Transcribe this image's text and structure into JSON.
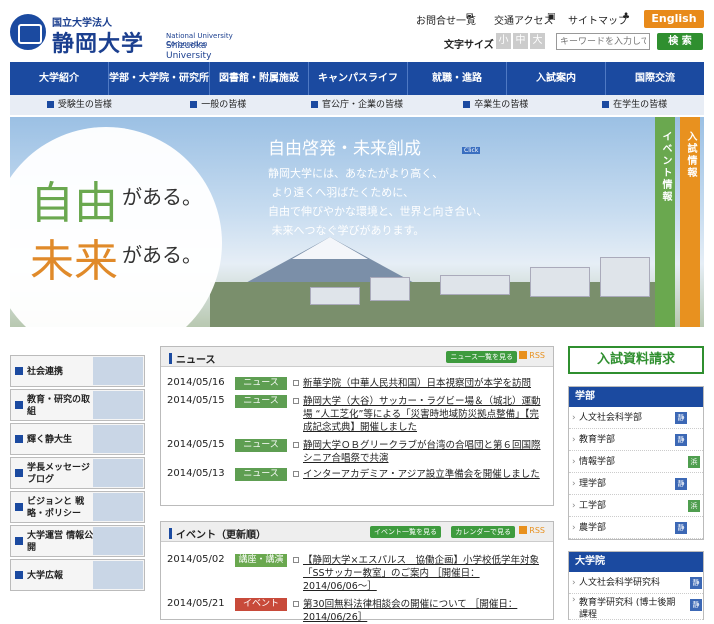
{
  "header": {
    "logo_small": "国立大学法人",
    "logo_big": "静岡大学",
    "logo_en1": "National University Corporation",
    "logo_en2": "Shizuoka University",
    "util": [
      "お問合せ一覧",
      "交通アクセス",
      "サイトマップ"
    ],
    "lang": "English",
    "font_size_label": "文字サイズ",
    "font_sizes": [
      "小",
      "中",
      "大"
    ],
    "search_placeholder": "キーワードを入力して下",
    "search_button": "検 索"
  },
  "gnav": [
    "大学紹介",
    "学部・大学院・研究所",
    "図書館・附属施設",
    "キャンパスライフ",
    "就職・進路",
    "入試案内",
    "国際交流"
  ],
  "snav": [
    "受験生の皆様",
    "一般の皆様",
    "官公庁・企業の皆様",
    "卒業生の皆様",
    "在学生の皆様"
  ],
  "hero": {
    "line1_big": "自由",
    "line1_small": "がある。",
    "line2_big": "未来",
    "line2_small": "がある。",
    "title": "自由啓発・未来創成",
    "click": "Click",
    "message": "静岡大学には、あなたがより高く、\n より遠くへ羽ばたくために、\n自由で伸びやかな環境と、世界と向き合い、\n 未来へつなぐ学びがあります。",
    "tab_event": "イベント情報",
    "tab_admission": "入試情報"
  },
  "left_links": [
    "社会連携",
    "教育・研究の取組",
    "輝く静大生",
    "学長メッセージ ブログ",
    "ビジョンと 戦略・ポリシー",
    "大学運営 情報公開",
    "大学広報"
  ],
  "news": {
    "title": "ニュース",
    "list_button": "ニュース一覧を見る",
    "rss": "RSS",
    "items": [
      {
        "date": "2014/05/16",
        "tag": "ニュース",
        "text": "新華学院（中華人民共和国）日本視察団が本学を訪問"
      },
      {
        "date": "2014/05/15",
        "tag": "ニュース",
        "text": "静岡大学（大谷）サッカー・ラグビー場＆（城北）運動場 “人工芝化”等による「災害時地域防災拠点整備」【完成記念式典】開催しました"
      },
      {
        "date": "2014/05/15",
        "tag": "ニュース",
        "text": "静岡大学ＯＢグリークラブが台湾の合唱団と第６回国際シニア合唱祭で共演"
      },
      {
        "date": "2014/05/13",
        "tag": "ニュース",
        "text": "インターアカデミア・アジア設立準備会を開催しました"
      }
    ]
  },
  "events": {
    "title": "イベント（更新順）",
    "list_button": "イベント一覧を見る",
    "calendar_button": "カレンダーで見る",
    "rss": "RSS",
    "items": [
      {
        "date": "2014/05/02",
        "tag": "講座・講演",
        "text": "【静岡大学×エスパルス　協働企画】小学校低学年対象「SSサッカー教室」のご案内 ［開催日：2014/06/06〜］"
      },
      {
        "date": "2014/05/21",
        "tag": "イベント",
        "text": "第30回無料法律相談会の開催について ［開催日：2014/06/26］"
      }
    ]
  },
  "right": {
    "brochure": "入試資料請求",
    "faculties_title": "学部",
    "faculties": [
      {
        "name": "人文社会科学部",
        "badge": "静",
        "kind": "s"
      },
      {
        "name": "教育学部",
        "badge": "静",
        "kind": "s"
      },
      {
        "name": "情報学部",
        "badge": "浜",
        "kind": "h"
      },
      {
        "name": "理学部",
        "badge": "静",
        "kind": "s"
      },
      {
        "name": "工学部",
        "badge": "浜",
        "kind": "h"
      },
      {
        "name": "農学部",
        "badge": "静",
        "kind": "s"
      }
    ],
    "grad_title": "大学院",
    "grad": [
      {
        "name": "人文社会科学研究科",
        "badge": "静",
        "kind": "s"
      },
      {
        "name": "教育学研究科 (博士後期課程",
        "badge": "静",
        "kind": "s"
      }
    ]
  }
}
